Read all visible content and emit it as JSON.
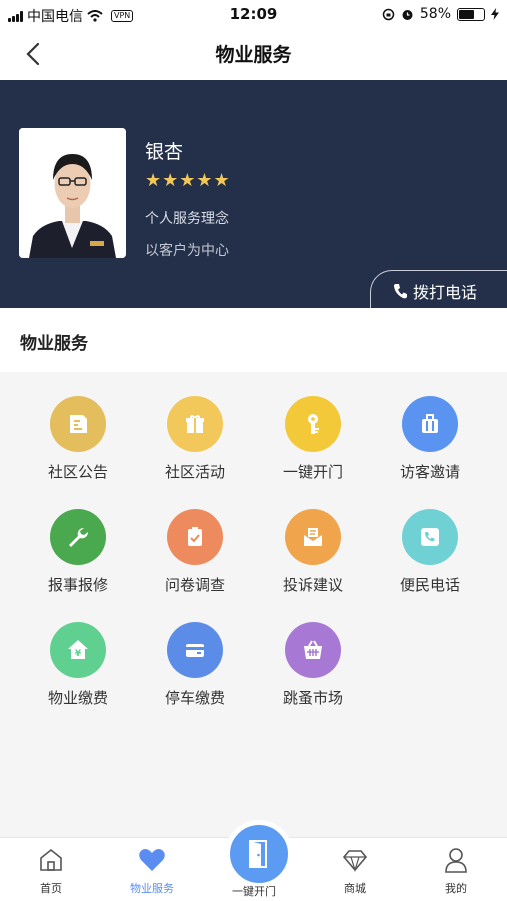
{
  "status_bar": {
    "carrier": "中国电信",
    "vpn": "VPN",
    "time": "12:09",
    "battery": "58%"
  },
  "header": {
    "title": "物业服务"
  },
  "profile": {
    "name": "银杏",
    "rating": "★★★★★",
    "motto_title": "个人服务理念",
    "motto": "以客户为中心",
    "call_label": "拨打电话"
  },
  "section": {
    "title": "物业服务"
  },
  "services": [
    {
      "label": "社区公告",
      "icon": "notice-icon",
      "color": "#e4bd5c"
    },
    {
      "label": "社区活动",
      "icon": "gift-icon",
      "color": "#f3c85a"
    },
    {
      "label": "一键开门",
      "icon": "key-icon",
      "color": "#f3c93a"
    },
    {
      "label": "访客邀请",
      "icon": "suitcase-icon",
      "color": "#5b93f0"
    },
    {
      "label": "报事报修",
      "icon": "wrench-icon",
      "color": "#4aa84f"
    },
    {
      "label": "问卷调查",
      "icon": "clipboard-icon",
      "color": "#ee8b5e"
    },
    {
      "label": "投诉建议",
      "icon": "mail-icon",
      "color": "#f0a54d"
    },
    {
      "label": "便民电话",
      "icon": "phone-icon",
      "color": "#6fd1d3"
    },
    {
      "label": "物业缴费",
      "icon": "house-yen-icon",
      "color": "#5fd08f"
    },
    {
      "label": "停车缴费",
      "icon": "card-icon",
      "color": "#5b8de8"
    },
    {
      "label": "跳蚤市场",
      "icon": "basket-icon",
      "color": "#a779d4"
    }
  ],
  "tabbar": {
    "home": "首页",
    "property": "物业服务",
    "door": "一键开门",
    "mall": "商城",
    "mine": "我的"
  }
}
